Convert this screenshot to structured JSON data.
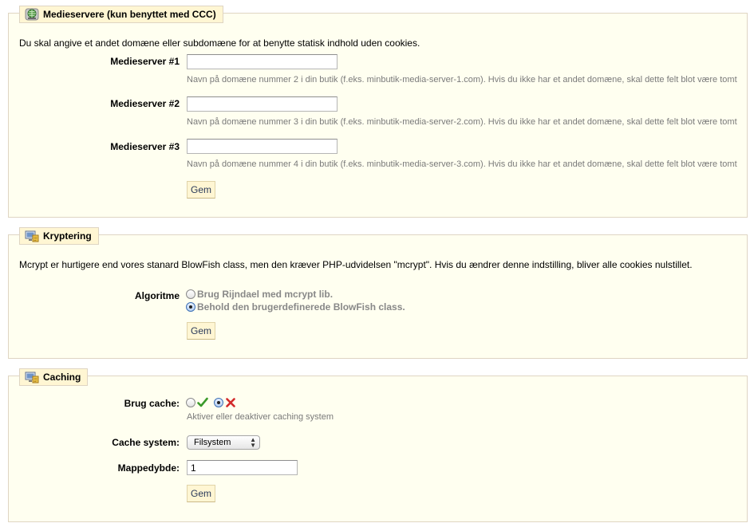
{
  "media": {
    "legend": "Medieservere (kun benyttet med CCC)",
    "intro": "Du skal angive et andet domæne eller subdomæne for at benytte statisk indhold uden cookies.",
    "servers": [
      {
        "label": "Medieserver #1",
        "value": "",
        "hint": "Navn på domæne nummer 2 i din butik (f.eks. minbutik-media-server-1.com). Hvis du ikke har et andet domæne, skal dette felt blot være tomt"
      },
      {
        "label": "Medieserver #2",
        "value": "",
        "hint": "Navn på domæne nummer 3 i din butik (f.eks. minbutik-media-server-2.com). Hvis du ikke har et andet domæne, skal dette felt blot være tomt"
      },
      {
        "label": "Medieserver #3",
        "value": "",
        "hint": "Navn på domæne nummer 4 i din butik (f.eks. minbutik-media-server-3.com). Hvis du ikke har et andet domæne, skal dette felt blot være tomt"
      }
    ],
    "save_label": "Gem",
    "icon": "globe-server-icon"
  },
  "crypto": {
    "legend": "Kryptering",
    "intro": "Mcrypt er hurtigere end vores stanard BlowFish class, men den kræver PHP-udvidelsen \"mcrypt\". Hvis du ændrer denne indstilling, bliver alle cookies nulstillet.",
    "algorithm_label": "Algoritme",
    "options": [
      {
        "label": "Brug Rijndael med mcrypt lib.",
        "selected": false
      },
      {
        "label": "Behold den brugerdefinerede BlowFish class.",
        "selected": true
      }
    ],
    "save_label": "Gem",
    "icon": "computer-settings-icon"
  },
  "caching": {
    "legend": "Caching",
    "use_cache_label": "Brug cache:",
    "use_cache_enabled": false,
    "use_cache_hint": "Aktiver eller deaktiver caching system",
    "cache_system_label": "Cache system:",
    "cache_system_value": "Filsystem",
    "depth_label": "Mappedybde:",
    "depth_value": "1",
    "save_label": "Gem",
    "icon": "computer-settings-icon"
  },
  "colors": {
    "panel_bg": "#fffff0",
    "legend_bg": "#fff6d3",
    "border": "#dfd5c3",
    "hint": "#7a7a7a",
    "enable_green": "#3a9a2a",
    "disable_red": "#d22a2a"
  }
}
